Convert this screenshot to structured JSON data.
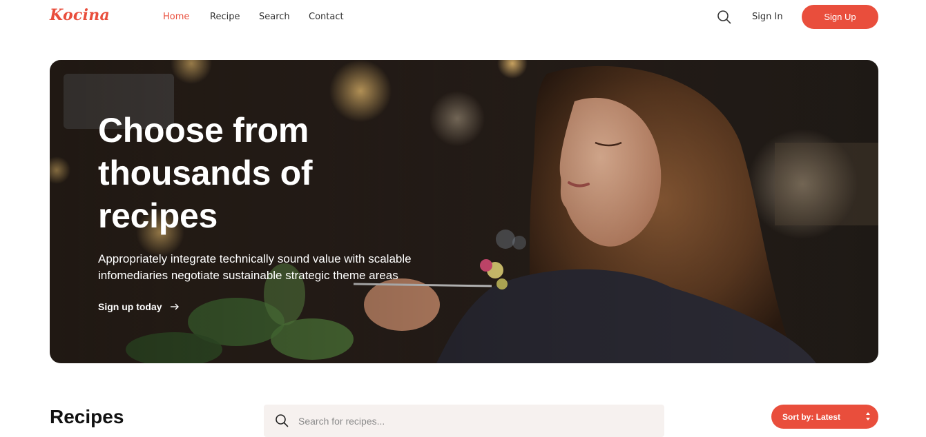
{
  "brand": {
    "logo_text": "Kocina",
    "accent": "#e94e3c"
  },
  "nav": {
    "items": [
      {
        "label": "Home",
        "active": true
      },
      {
        "label": "Recipe",
        "active": false
      },
      {
        "label": "Search",
        "active": false
      },
      {
        "label": "Contact",
        "active": false
      }
    ],
    "search_icon": "search-icon",
    "sign_in": "Sign In",
    "sign_up": "Sign Up"
  },
  "hero": {
    "title": "Choose from thousands of recipes",
    "subtitle": "Appropriately integrate technically sound value with scalable infomediaries negotiate sustainable strategic theme areas",
    "cta": "Sign up today",
    "cta_icon": "arrow-right-icon"
  },
  "recipes": {
    "heading": "Recipes",
    "search_placeholder": "Search for recipes...",
    "sort_label": "Sort by: Latest"
  }
}
